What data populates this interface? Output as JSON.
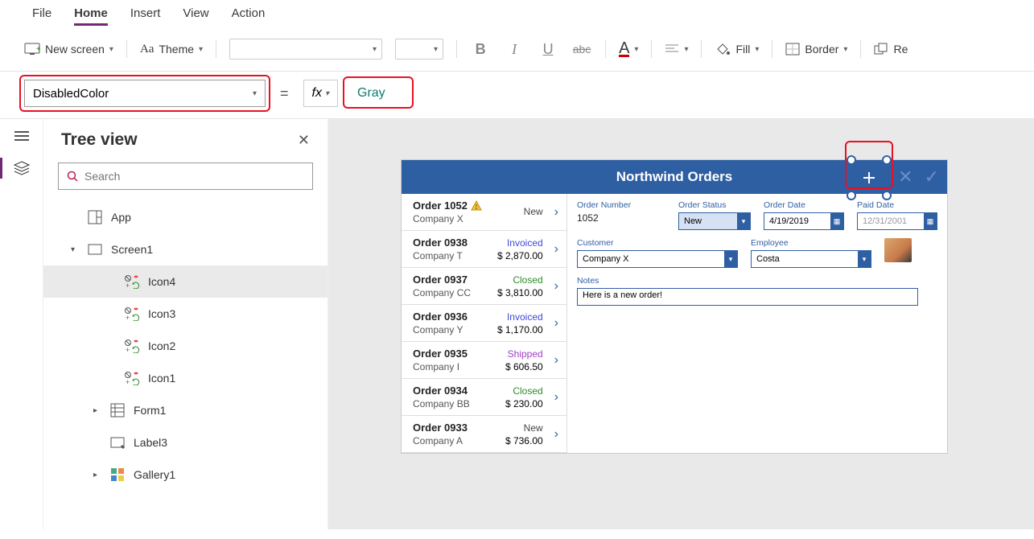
{
  "menu": {
    "items": [
      "File",
      "Home",
      "Insert",
      "View",
      "Action"
    ],
    "active": "Home"
  },
  "ribbon": {
    "new_screen": "New screen",
    "theme": "Theme",
    "fill": "Fill",
    "border": "Border",
    "reorder_partial": "Re"
  },
  "formula": {
    "property": "DisabledColor",
    "fx": "fx",
    "value": "Gray"
  },
  "tree": {
    "title": "Tree view",
    "search_placeholder": "Search",
    "nodes": [
      {
        "label": "App",
        "type": "app",
        "indent": 1
      },
      {
        "label": "Screen1",
        "type": "screen",
        "indent": 1,
        "expanded": true
      },
      {
        "label": "Icon4",
        "type": "icon-group",
        "indent": 3,
        "selected": true
      },
      {
        "label": "Icon3",
        "type": "icon-group",
        "indent": 3
      },
      {
        "label": "Icon2",
        "type": "icon-group",
        "indent": 3
      },
      {
        "label": "Icon1",
        "type": "icon-group",
        "indent": 3
      },
      {
        "label": "Form1",
        "type": "form",
        "indent": 2,
        "caret": true
      },
      {
        "label": "Label3",
        "type": "label",
        "indent": 2
      },
      {
        "label": "Gallery1",
        "type": "gallery",
        "indent": 2,
        "caret": true
      }
    ]
  },
  "screen": {
    "title": "Northwind Orders",
    "orders": [
      {
        "title": "Order 1052",
        "company": "Company X",
        "status": "New",
        "amount": "",
        "warn": true
      },
      {
        "title": "Order 0938",
        "company": "Company T",
        "status": "Invoiced",
        "amount": "$ 2,870.00"
      },
      {
        "title": "Order 0937",
        "company": "Company CC",
        "status": "Closed",
        "amount": "$ 3,810.00"
      },
      {
        "title": "Order 0936",
        "company": "Company Y",
        "status": "Invoiced",
        "amount": "$ 1,170.00"
      },
      {
        "title": "Order 0935",
        "company": "Company I",
        "status": "Shipped",
        "amount": "$ 606.50"
      },
      {
        "title": "Order 0934",
        "company": "Company BB",
        "status": "Closed",
        "amount": "$ 230.00"
      },
      {
        "title": "Order 0933",
        "company": "Company A",
        "status": "New",
        "amount": "$ 736.00"
      }
    ],
    "detail": {
      "labels": {
        "order_number": "Order Number",
        "order_status": "Order Status",
        "order_date": "Order Date",
        "paid_date": "Paid Date",
        "customer": "Customer",
        "employee": "Employee",
        "notes": "Notes"
      },
      "order_number": "1052",
      "order_status": "New",
      "order_date": "4/19/2019",
      "paid_date": "12/31/2001",
      "customer": "Company X",
      "employee": "Costa",
      "notes": "Here is a new order!"
    }
  }
}
